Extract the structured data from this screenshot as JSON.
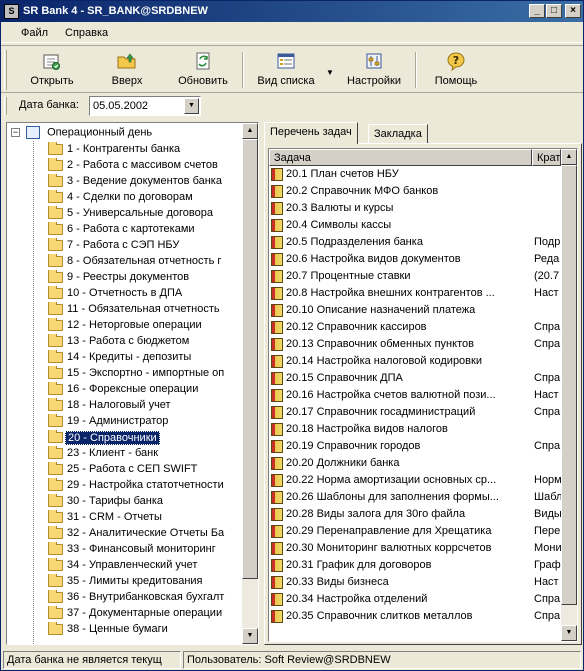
{
  "window": {
    "title": "SR Bank 4 - SR_BANK@SRDBNEW",
    "title_icon": "S",
    "minimize": "_",
    "maximize": "□",
    "close": "×"
  },
  "menu": [
    "Файл",
    "Справка"
  ],
  "toolbar": {
    "open": "Открыть",
    "up": "Вверх",
    "refresh": "Обновить",
    "view": "Вид списка",
    "settings": "Настройки",
    "help": "Помощь"
  },
  "date": {
    "label": "Дата банка:",
    "value": "05.05.2002"
  },
  "tree": {
    "root": "Операционный день",
    "items": [
      "1 - Контрагенты банка",
      "2 - Работа с массивом счетов",
      "3 - Ведение документов банка",
      "4 - Сделки по договорам",
      "5 - Универсальные договора",
      "6 - Работа с картотеками",
      "7 - Работа с СЭП НБУ",
      "8 - Обязательная отчетность г",
      "9 - Реестры документов",
      "10 - Отчетность в ДПА",
      "11 - Обязательная отчетность",
      "12 - Неторговые операции",
      "13 - Работа с бюджетом",
      "14 - Кредиты - депозиты",
      "15 - Экспортно - импортные оп",
      "16 - Форексные операции",
      "18 - Налоговый учет",
      "19 - Администратор",
      "20 - Справочники",
      "23 - Клиент - банк",
      "25 - Работа с СЕП SWIFT",
      "29 - Настройка статотчетности",
      "30 - Тарифы банка",
      "31 - CRM  -  Отчеты",
      "32 - Аналитические Отчеты Ба",
      "33 - Финансовый мониторинг",
      "34 - Управленческий учет",
      "35 - Лимиты кредитования",
      "36 - Внутрибанковская бухгалт",
      "37 - Документарные операции",
      "38 - Ценные бумаги"
    ],
    "selected_index": 18
  },
  "tabs": [
    "Перечень задач",
    "Закладка"
  ],
  "grid": {
    "columns": [
      "Задача",
      "Крат"
    ],
    "rows": [
      [
        "20.1 План счетов НБУ",
        ""
      ],
      [
        "20.2 Справочник МФО банков",
        ""
      ],
      [
        "20.3 Валюты и курсы",
        ""
      ],
      [
        "20.4 Символы кассы",
        ""
      ],
      [
        "20.5 Подразделения банка",
        "Подр"
      ],
      [
        "20.6 Настройка видов документов",
        "Реда"
      ],
      [
        "20.7  Процентные ставки",
        "(20.7"
      ],
      [
        "20.8 Настройка внешних контрагентов ...",
        "Наст"
      ],
      [
        "20.10 Описание назначений платежа",
        ""
      ],
      [
        "20.12 Справочник кассиров",
        "Спра"
      ],
      [
        "20.13 Справочник обменных пунктов",
        "Спра"
      ],
      [
        "20.14 Настройка налоговой кодировки",
        ""
      ],
      [
        "20.15 Справочник ДПА",
        "Спра"
      ],
      [
        "20.16 Настройка счетов валютной пози...",
        "Наст"
      ],
      [
        "20.17 Справочник госадминистраций",
        "Спра"
      ],
      [
        "20.18 Настройка видов налогов",
        ""
      ],
      [
        "20.19 Справочник городов",
        "Спра"
      ],
      [
        "20.20 Должники банка",
        ""
      ],
      [
        "20.22 Норма амортизации основных ср...",
        "Норм"
      ],
      [
        "20.26 Шаблоны для заполнения формы...",
        "Шабл"
      ],
      [
        "20.28 Виды залога для 30го файла",
        "Виды"
      ],
      [
        "20.29 Перенаправление для Хрещатика",
        "Пере"
      ],
      [
        "20.30 Мониторинг валютных коррсчетов",
        "Мони"
      ],
      [
        "20.31 График для договоров",
        "Граф"
      ],
      [
        "20.33 Виды бизнеса",
        "Наст"
      ],
      [
        "20.34   Настройка отделений",
        "Спра"
      ],
      [
        "20.35 Справочник слитков металлов",
        "Спра"
      ]
    ]
  },
  "status": {
    "left": "Дата банка не является текущ",
    "right": "Пользователь: Soft Review@SRDBNEW"
  }
}
